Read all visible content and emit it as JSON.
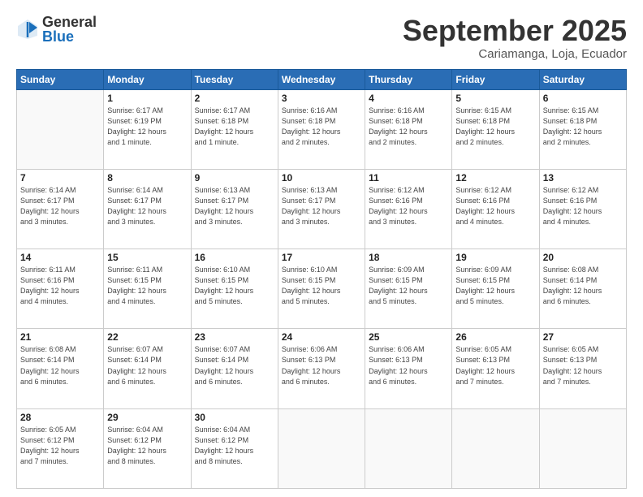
{
  "logo": {
    "general": "General",
    "blue": "Blue"
  },
  "title": "September 2025",
  "subtitle": "Cariamanga, Loja, Ecuador",
  "weekdays": [
    "Sunday",
    "Monday",
    "Tuesday",
    "Wednesday",
    "Thursday",
    "Friday",
    "Saturday"
  ],
  "weeks": [
    [
      {
        "day": "",
        "info": ""
      },
      {
        "day": "1",
        "info": "Sunrise: 6:17 AM\nSunset: 6:19 PM\nDaylight: 12 hours\nand 1 minute."
      },
      {
        "day": "2",
        "info": "Sunrise: 6:17 AM\nSunset: 6:18 PM\nDaylight: 12 hours\nand 1 minute."
      },
      {
        "day": "3",
        "info": "Sunrise: 6:16 AM\nSunset: 6:18 PM\nDaylight: 12 hours\nand 2 minutes."
      },
      {
        "day": "4",
        "info": "Sunrise: 6:16 AM\nSunset: 6:18 PM\nDaylight: 12 hours\nand 2 minutes."
      },
      {
        "day": "5",
        "info": "Sunrise: 6:15 AM\nSunset: 6:18 PM\nDaylight: 12 hours\nand 2 minutes."
      },
      {
        "day": "6",
        "info": "Sunrise: 6:15 AM\nSunset: 6:18 PM\nDaylight: 12 hours\nand 2 minutes."
      }
    ],
    [
      {
        "day": "7",
        "info": "Sunrise: 6:14 AM\nSunset: 6:17 PM\nDaylight: 12 hours\nand 3 minutes."
      },
      {
        "day": "8",
        "info": "Sunrise: 6:14 AM\nSunset: 6:17 PM\nDaylight: 12 hours\nand 3 minutes."
      },
      {
        "day": "9",
        "info": "Sunrise: 6:13 AM\nSunset: 6:17 PM\nDaylight: 12 hours\nand 3 minutes."
      },
      {
        "day": "10",
        "info": "Sunrise: 6:13 AM\nSunset: 6:17 PM\nDaylight: 12 hours\nand 3 minutes."
      },
      {
        "day": "11",
        "info": "Sunrise: 6:12 AM\nSunset: 6:16 PM\nDaylight: 12 hours\nand 3 minutes."
      },
      {
        "day": "12",
        "info": "Sunrise: 6:12 AM\nSunset: 6:16 PM\nDaylight: 12 hours\nand 4 minutes."
      },
      {
        "day": "13",
        "info": "Sunrise: 6:12 AM\nSunset: 6:16 PM\nDaylight: 12 hours\nand 4 minutes."
      }
    ],
    [
      {
        "day": "14",
        "info": "Sunrise: 6:11 AM\nSunset: 6:16 PM\nDaylight: 12 hours\nand 4 minutes."
      },
      {
        "day": "15",
        "info": "Sunrise: 6:11 AM\nSunset: 6:15 PM\nDaylight: 12 hours\nand 4 minutes."
      },
      {
        "day": "16",
        "info": "Sunrise: 6:10 AM\nSunset: 6:15 PM\nDaylight: 12 hours\nand 5 minutes."
      },
      {
        "day": "17",
        "info": "Sunrise: 6:10 AM\nSunset: 6:15 PM\nDaylight: 12 hours\nand 5 minutes."
      },
      {
        "day": "18",
        "info": "Sunrise: 6:09 AM\nSunset: 6:15 PM\nDaylight: 12 hours\nand 5 minutes."
      },
      {
        "day": "19",
        "info": "Sunrise: 6:09 AM\nSunset: 6:15 PM\nDaylight: 12 hours\nand 5 minutes."
      },
      {
        "day": "20",
        "info": "Sunrise: 6:08 AM\nSunset: 6:14 PM\nDaylight: 12 hours\nand 6 minutes."
      }
    ],
    [
      {
        "day": "21",
        "info": "Sunrise: 6:08 AM\nSunset: 6:14 PM\nDaylight: 12 hours\nand 6 minutes."
      },
      {
        "day": "22",
        "info": "Sunrise: 6:07 AM\nSunset: 6:14 PM\nDaylight: 12 hours\nand 6 minutes."
      },
      {
        "day": "23",
        "info": "Sunrise: 6:07 AM\nSunset: 6:14 PM\nDaylight: 12 hours\nand 6 minutes."
      },
      {
        "day": "24",
        "info": "Sunrise: 6:06 AM\nSunset: 6:13 PM\nDaylight: 12 hours\nand 6 minutes."
      },
      {
        "day": "25",
        "info": "Sunrise: 6:06 AM\nSunset: 6:13 PM\nDaylight: 12 hours\nand 6 minutes."
      },
      {
        "day": "26",
        "info": "Sunrise: 6:05 AM\nSunset: 6:13 PM\nDaylight: 12 hours\nand 7 minutes."
      },
      {
        "day": "27",
        "info": "Sunrise: 6:05 AM\nSunset: 6:13 PM\nDaylight: 12 hours\nand 7 minutes."
      }
    ],
    [
      {
        "day": "28",
        "info": "Sunrise: 6:05 AM\nSunset: 6:12 PM\nDaylight: 12 hours\nand 7 minutes."
      },
      {
        "day": "29",
        "info": "Sunrise: 6:04 AM\nSunset: 6:12 PM\nDaylight: 12 hours\nand 8 minutes."
      },
      {
        "day": "30",
        "info": "Sunrise: 6:04 AM\nSunset: 6:12 PM\nDaylight: 12 hours\nand 8 minutes."
      },
      {
        "day": "",
        "info": ""
      },
      {
        "day": "",
        "info": ""
      },
      {
        "day": "",
        "info": ""
      },
      {
        "day": "",
        "info": ""
      }
    ]
  ]
}
